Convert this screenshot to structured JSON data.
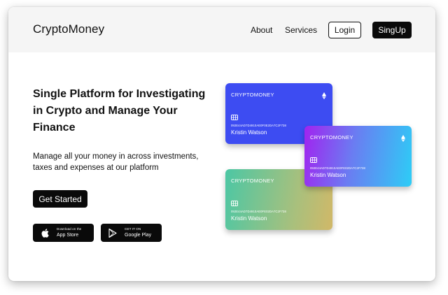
{
  "header": {
    "logo": "CryptoMoney",
    "nav": [
      "About",
      "Services"
    ],
    "login_label": "Login",
    "signup_label": "SingUp"
  },
  "hero": {
    "title_lines": [
      "Single Platform for Investigating",
      "in Crypto and Manage Your",
      "Finance"
    ],
    "subtitle_lines": [
      "Manage all your money in across investments,",
      "taxes and expenses at our platform"
    ],
    "cta_label": "Get Started"
  },
  "stores": {
    "apple": {
      "small": "Download on the",
      "big": "App Store",
      "icon": "apple-icon"
    },
    "google": {
      "small": "GET IT ON",
      "big": "Google Play",
      "icon": "play-icon"
    }
  },
  "cards": {
    "blue": {
      "brand": "CRYPTOMONEY",
      "number": "092E44AD7D4910AE0F0E2DA7C2F738",
      "holder": "Kristin Watson",
      "color": "#3d4cf2"
    },
    "purple": {
      "brand": "CRYPTOMONEY",
      "number": "092E44AD7D4910AE0FE02DA7C2F738",
      "holder": "Kristin Watson",
      "colors": [
        "#a123ef",
        "#2dcdf6"
      ]
    },
    "green": {
      "brand": "CRYPTOMONEY",
      "number": "092E44AD7D4910AE0FE02DA7C2F738",
      "holder": "Kristin Watson",
      "colors": [
        "#4cc7a4",
        "#d1b868"
      ]
    }
  }
}
